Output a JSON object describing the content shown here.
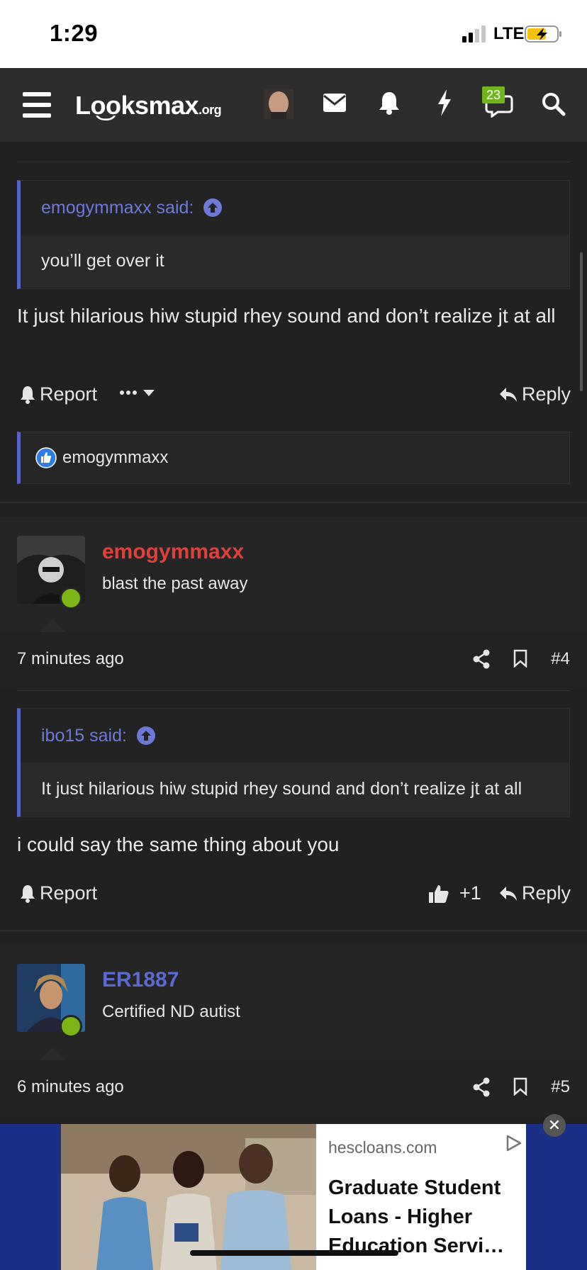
{
  "status": {
    "time": "1:29",
    "network": "LTE"
  },
  "nav": {
    "logo_main": "Lo͜oksmax",
    "logo_suffix": ".org",
    "chat_badge": "23",
    "icons": [
      "menu-icon",
      "envelope-icon",
      "bell-icon",
      "bolt-icon",
      "chat-icon",
      "search-icon"
    ]
  },
  "post3": {
    "quote_author": "emogymmaxx said:",
    "quote_text": "you’ll get over it",
    "text": "It just hilarious hiw stupid rhey sound and don’t realize jt at all",
    "report_label": "Report",
    "reply_label": "Reply",
    "reaction_user": "emogymmaxx"
  },
  "post4": {
    "username": "emogymmaxx",
    "user_title": "blast the past away",
    "time": "7 minutes ago",
    "number": "#4",
    "quote_author": "ibo15 said:",
    "quote_text": "It just hilarious hiw stupid rhey sound and don’t realize jt at all",
    "text": "i could say the same thing about you",
    "report_label": "Report",
    "like_count": "+1",
    "reply_label": "Reply"
  },
  "post5": {
    "username": "ER1887",
    "user_title": "Certified ND autist",
    "time": "6 minutes ago",
    "number": "#5"
  },
  "ad": {
    "domain": "hescloans.com",
    "headline": "Graduate Student Loans - Higher Education Servi…"
  },
  "colors": {
    "accent": "#5865c8",
    "username_red": "#e0403a",
    "username_blue": "#5b6ad0",
    "online": "#7ab515",
    "badge": "#6fb51d"
  }
}
